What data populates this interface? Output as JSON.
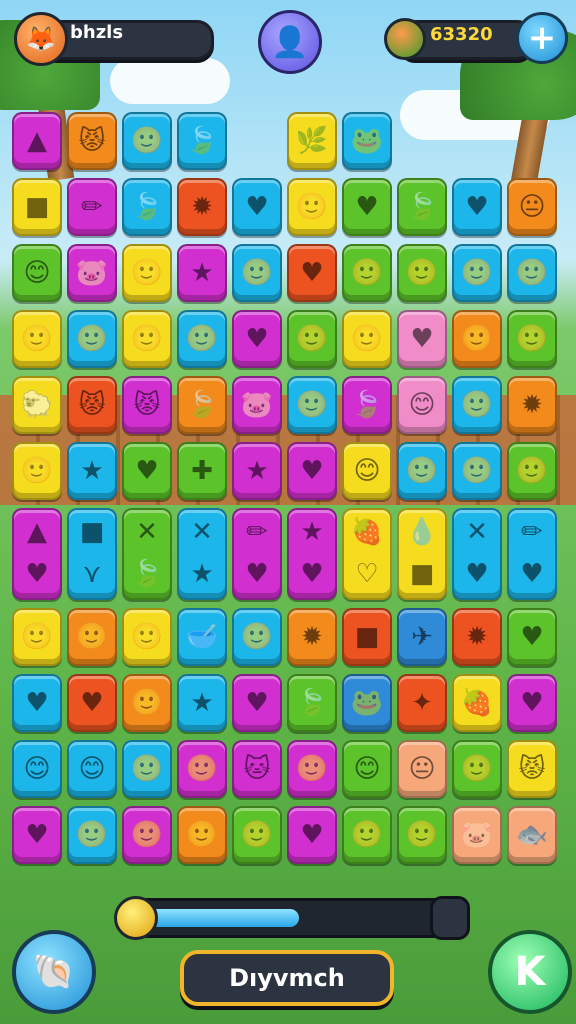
{
  "header": {
    "player_name": "bhzls",
    "score": "63320",
    "avatar_icon": "fox-face-icon",
    "center_icon": "profile-icon",
    "currency_icon": "fruit-coin-icon",
    "add_label": "+"
  },
  "board": {
    "colors": {
      "M": "#d22fd0",
      "O": "#f28a1c",
      "C": "#1cb6ea",
      "Y": "#f6dc1e",
      "G": "#5cc42a",
      "R": "#ec5320",
      "P": "#a02ee0",
      "K": "#f08cc8",
      "S": "#f6a87a",
      "B": "#2f8bd8"
    },
    "rows": [
      [
        {
          "c": "M",
          "g": "▲"
        },
        {
          "c": "O",
          "g": "😾"
        },
        {
          "c": "C",
          "g": "🙂"
        },
        {
          "c": "C",
          "g": "🍃"
        },
        {
          "c": "",
          "g": ""
        },
        {
          "c": "Y",
          "g": "🌿"
        },
        {
          "c": "C",
          "g": "🐸"
        },
        {
          "c": "",
          "g": ""
        },
        {
          "c": "",
          "g": ""
        },
        {
          "c": "",
          "g": ""
        }
      ],
      [
        {
          "c": "Y",
          "g": "■"
        },
        {
          "c": "M",
          "g": "✏"
        },
        {
          "c": "C",
          "g": "🍃"
        },
        {
          "c": "R",
          "g": "✹"
        },
        {
          "c": "C",
          "g": "♥"
        },
        {
          "c": "Y",
          "g": "🙂"
        },
        {
          "c": "G",
          "g": "♥"
        },
        {
          "c": "G",
          "g": "🍃"
        },
        {
          "c": "C",
          "g": "♥"
        },
        {
          "c": "O",
          "g": "😐"
        }
      ],
      [
        {
          "c": "G",
          "g": "😊"
        },
        {
          "c": "M",
          "g": "🐷"
        },
        {
          "c": "Y",
          "g": "🙂"
        },
        {
          "c": "M",
          "g": "★"
        },
        {
          "c": "C",
          "g": "🙂"
        },
        {
          "c": "R",
          "g": "♥"
        },
        {
          "c": "G",
          "g": "🙂"
        },
        {
          "c": "G",
          "g": "🙂"
        },
        {
          "c": "C",
          "g": "🙂"
        },
        {
          "c": "C",
          "g": "🙂"
        }
      ],
      [
        {
          "c": "Y",
          "g": "🙂"
        },
        {
          "c": "C",
          "g": "🙂"
        },
        {
          "c": "Y",
          "g": "🙂"
        },
        {
          "c": "C",
          "g": "🙂"
        },
        {
          "c": "M",
          "g": "♥"
        },
        {
          "c": "G",
          "g": "🙂"
        },
        {
          "c": "Y",
          "g": "🙂"
        },
        {
          "c": "K",
          "g": "♥"
        },
        {
          "c": "O",
          "g": "🙂"
        },
        {
          "c": "G",
          "g": "🙂"
        }
      ],
      [
        {
          "c": "Y",
          "g": "🐑"
        },
        {
          "c": "R",
          "g": "😾"
        },
        {
          "c": "M",
          "g": "😾"
        },
        {
          "c": "O",
          "g": "🍃"
        },
        {
          "c": "M",
          "g": "🐷"
        },
        {
          "c": "C",
          "g": "🙂"
        },
        {
          "c": "M",
          "g": "🍃"
        },
        {
          "c": "K",
          "g": "😊"
        },
        {
          "c": "C",
          "g": "🙂"
        },
        {
          "c": "O",
          "g": "✹"
        }
      ],
      [
        {
          "c": "Y",
          "g": "🙂"
        },
        {
          "c": "C",
          "g": "★"
        },
        {
          "c": "G",
          "g": "♥"
        },
        {
          "c": "G",
          "g": "✚"
        },
        {
          "c": "M",
          "g": "★"
        },
        {
          "c": "M",
          "g": "♥"
        },
        {
          "c": "Y",
          "g": "😊"
        },
        {
          "c": "C",
          "g": "🙂"
        },
        {
          "c": "C",
          "g": "🙂"
        },
        {
          "c": "G",
          "g": "🙂"
        }
      ],
      [
        {
          "c": "M",
          "g": "▲ ♥"
        },
        {
          "c": "C",
          "g": "■ ⋎"
        },
        {
          "c": "G",
          "g": "✕ 🍃"
        },
        {
          "c": "C",
          "g": "✕ ★"
        },
        {
          "c": "M",
          "g": "✏ ♥"
        },
        {
          "c": "M",
          "g": "★ ♥"
        },
        {
          "c": "Y",
          "g": "🍓 ♡"
        },
        {
          "c": "Y",
          "g": "💧 ■"
        },
        {
          "c": "C",
          "g": "✕ ♥"
        },
        {
          "c": "C",
          "g": "✏ ♥"
        }
      ],
      [
        {
          "c": "Y",
          "g": "🙂"
        },
        {
          "c": "O",
          "g": "🙂"
        },
        {
          "c": "Y",
          "g": "🙂"
        },
        {
          "c": "C",
          "g": "🥣"
        },
        {
          "c": "C",
          "g": "🙂"
        },
        {
          "c": "O",
          "g": "✹"
        },
        {
          "c": "R",
          "g": "■"
        },
        {
          "c": "B",
          "g": "✈"
        },
        {
          "c": "R",
          "g": "✹"
        },
        {
          "c": "G",
          "g": "♥"
        }
      ],
      [
        {
          "c": "C",
          "g": "♥"
        },
        {
          "c": "R",
          "g": "♥"
        },
        {
          "c": "O",
          "g": "🙂"
        },
        {
          "c": "C",
          "g": "★"
        },
        {
          "c": "M",
          "g": "♥"
        },
        {
          "c": "G",
          "g": "🍃"
        },
        {
          "c": "B",
          "g": "🐸"
        },
        {
          "c": "R",
          "g": "✦"
        },
        {
          "c": "Y",
          "g": "🍓"
        },
        {
          "c": "M",
          "g": "♥"
        }
      ],
      [
        {
          "c": "C",
          "g": "😊"
        },
        {
          "c": "C",
          "g": "😊"
        },
        {
          "c": "C",
          "g": "🙂"
        },
        {
          "c": "M",
          "g": "🙂"
        },
        {
          "c": "M",
          "g": "🐱"
        },
        {
          "c": "M",
          "g": "🙂"
        },
        {
          "c": "G",
          "g": "😊"
        },
        {
          "c": "S",
          "g": "😐"
        },
        {
          "c": "G",
          "g": "🙂"
        },
        {
          "c": "Y",
          "g": "😾"
        }
      ],
      [
        {
          "c": "M",
          "g": "♥"
        },
        {
          "c": "C",
          "g": "🙂"
        },
        {
          "c": "M",
          "g": "🙂"
        },
        {
          "c": "O",
          "g": "🙂"
        },
        {
          "c": "G",
          "g": "🙂"
        },
        {
          "c": "M",
          "g": "♥"
        },
        {
          "c": "G",
          "g": "🙂"
        },
        {
          "c": "G",
          "g": "🙂"
        },
        {
          "c": "S",
          "g": "🐷"
        },
        {
          "c": "S",
          "g": "🐟"
        }
      ]
    ]
  },
  "progress": {
    "value": 0.52
  },
  "footer": {
    "left_icon": "shell-icon",
    "main_button_label": "Dıyvmch",
    "right_icon": "k-icon",
    "right_label": "K"
  }
}
